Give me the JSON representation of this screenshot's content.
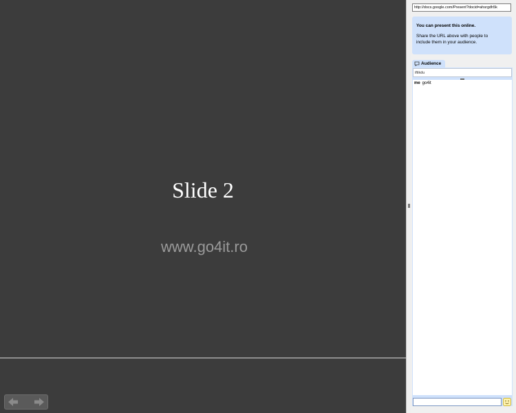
{
  "slide": {
    "title": "Slide 2",
    "subtitle": "www.go4it.ro"
  },
  "navigation": {
    "prev_icon": "arrow-left-icon",
    "next_icon": "arrow-right-icon",
    "pager": ""
  },
  "sidebar": {
    "share_url": "http://docs.google.com/Present?docid=ahsrgdh5k",
    "info_title": "You can present this online.",
    "info_body": "Share the URL above with people to include them in your audience.",
    "audience_tab_label": "Audience",
    "audience_tab_icon": "chat-bubble-icon",
    "audience_field_value": "iftikdu",
    "audience": [
      {
        "name": "me",
        "value": "go4it"
      }
    ],
    "chat_input_placeholder": "",
    "emoji_icon": "emoji-smiley-icon"
  },
  "colors": {
    "stage_bg": "#3c3c3c",
    "panel_blue": "#cfe1fb",
    "subtitle_gray": "#9a9a9a"
  }
}
